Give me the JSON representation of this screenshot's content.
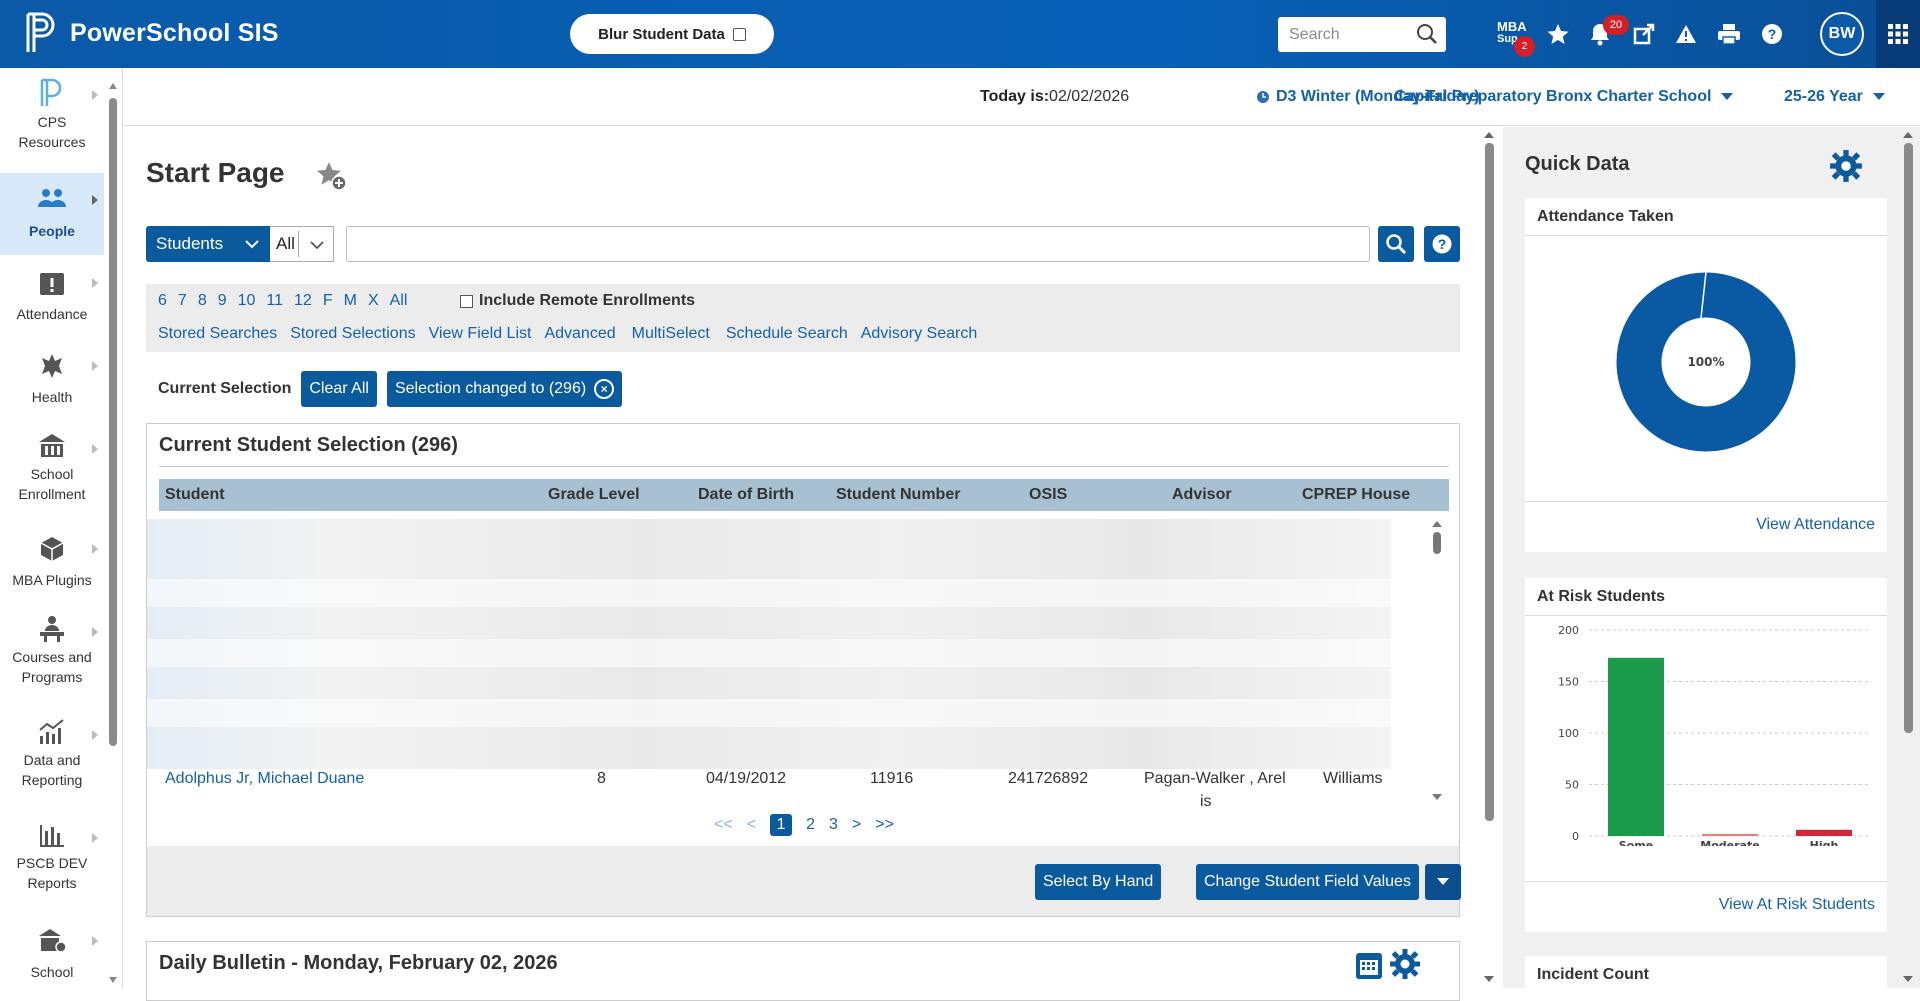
{
  "app": {
    "name": "PowerSchool SIS",
    "blur_label": "Blur Student Data"
  },
  "header": {
    "search_placeholder": "Search",
    "mba_line1": "MBA",
    "mba_line2": "Sup",
    "mba_badge": "2",
    "notifications_badge": "20",
    "user_initials": "BW"
  },
  "sidebar": {
    "items": [
      {
        "label_1": "CPS",
        "label_2": "Resources"
      },
      {
        "label_1": "People",
        "label_2": ""
      },
      {
        "label_1": "Attendance",
        "label_2": ""
      },
      {
        "label_1": "Health",
        "label_2": ""
      },
      {
        "label_1": "School",
        "label_2": "Enrollment"
      },
      {
        "label_1": "MBA Plugins",
        "label_2": ""
      },
      {
        "label_1": "Courses and",
        "label_2": "Programs"
      },
      {
        "label_1": "Data and",
        "label_2": "Reporting"
      },
      {
        "label_1": "PSCB DEV",
        "label_2": "Reports"
      },
      {
        "label_1": "School",
        "label_2": ""
      }
    ]
  },
  "infobar": {
    "today_label": "Today is:",
    "today_value": "02/02/2026",
    "term": "D3 Winter (Monday-Friday)",
    "school": "Capital Preparatory Bronx Charter School",
    "year": "25-26 Year"
  },
  "main": {
    "title": "Start Page",
    "search_type": "Students",
    "search_scope": "All",
    "grades": [
      "6",
      "7",
      "8",
      "9",
      "10",
      "11",
      "12",
      "F",
      "M",
      "X",
      "All"
    ],
    "remote_label": "Include Remote Enrollments",
    "links": [
      "Stored Searches",
      "Stored Selections",
      "View Field List",
      "Advanced",
      "MultiSelect",
      "Schedule Search",
      "Advisory Search"
    ],
    "current_selection_label": "Current Selection",
    "clear_all": "Clear All",
    "selection_changed": "Selection changed to (296)",
    "panel_title": "Current Student Selection (296)",
    "columns": [
      "Student",
      "Grade Level",
      "Date of Birth",
      "Student Number",
      "OSIS",
      "Advisor",
      "CPREP House"
    ],
    "visible_row": {
      "student": "Adolphus Jr, Michael Duane",
      "grade": "8",
      "dob": "04/19/2012",
      "number": "11916",
      "osis": "241726892",
      "advisor_1": "Pagan-Walker , Arel",
      "advisor_2": "is",
      "house": "Williams"
    },
    "pager": {
      "first": "<<",
      "prev": "<",
      "pages": [
        "1",
        "2",
        "3"
      ],
      "next": ">",
      "last": ">>"
    },
    "select_by_hand": "Select By Hand",
    "change_values": "Change Student Field Values",
    "bulletin_title": "Daily Bulletin - Monday, February 02, 2026"
  },
  "quick": {
    "title": "Quick Data",
    "attendance_title": "Attendance Taken",
    "attendance_pct_label": "100%",
    "attendance_pct": 100,
    "view_attendance": "View Attendance",
    "risk_title": "At Risk Students",
    "view_risk": "View At Risk Students",
    "incident_title": "Incident Count"
  },
  "chart_data": [
    {
      "type": "pie",
      "title": "Attendance Taken",
      "center_label": "100%",
      "values": [
        100
      ]
    },
    {
      "type": "bar",
      "title": "At Risk Students",
      "categories": [
        "Some",
        "Moderate",
        "High"
      ],
      "values": [
        173,
        2,
        6
      ],
      "colors": [
        "#1a9a4a",
        "#e8807a",
        "#d0283a"
      ],
      "ylim": [
        0,
        200
      ],
      "yticks": [
        0,
        50,
        100,
        150,
        200
      ]
    }
  ]
}
